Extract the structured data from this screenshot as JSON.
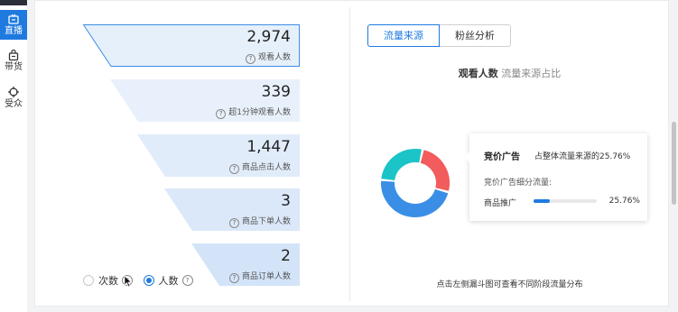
{
  "nav": {
    "items": [
      {
        "label": "直播",
        "icon": "broadcast-icon",
        "active": true
      },
      {
        "label": "带货",
        "icon": "shopping-bag-icon",
        "active": false
      },
      {
        "label": "受众",
        "icon": "crosshair-icon",
        "active": false
      }
    ]
  },
  "funnel": {
    "stages": [
      {
        "value": "2,974",
        "label": "观看人数",
        "highlighted": true
      },
      {
        "value": "339",
        "label": "超1分钟观看人数"
      },
      {
        "value": "1,447",
        "label": "商品点击人数"
      },
      {
        "value": "3",
        "label": "商品下单人数"
      },
      {
        "value": "2",
        "label": "商品订单人数"
      }
    ],
    "help_glyph": "?"
  },
  "mode": {
    "options": [
      {
        "label": "次数",
        "selected": false
      },
      {
        "label": "人数",
        "selected": true
      }
    ]
  },
  "tabs": [
    {
      "label": "流量来源",
      "active": true
    },
    {
      "label": "粉丝分析",
      "active": false
    }
  ],
  "donut": {
    "title_bold": "观看人数",
    "title_sub": "流量来源占比"
  },
  "chart_data": {
    "type": "pie",
    "donut": true,
    "slices": [
      {
        "name": "竞价广告",
        "value": 25.76,
        "color": "#f25c5c"
      },
      {
        "value": 47.24,
        "color": "#3a8ee6"
      },
      {
        "value": 27.0,
        "color": "#1bc4c6"
      }
    ]
  },
  "tooltip": {
    "title": "竞价广告",
    "share": "占整体流量来源的25.76%",
    "subtitle": "竞价广告细分流量:",
    "item_label": "商品推广",
    "item_pct_text": "25.76%",
    "item_fraction": 0.2576
  },
  "footer": {
    "note": "点击左侧漏斗图可查看不同阶段流量分布"
  },
  "colors": {
    "accent": "#1f7ae0",
    "funnel_fill": "#e6f0fb",
    "nav_active": "#1f7ae0"
  }
}
